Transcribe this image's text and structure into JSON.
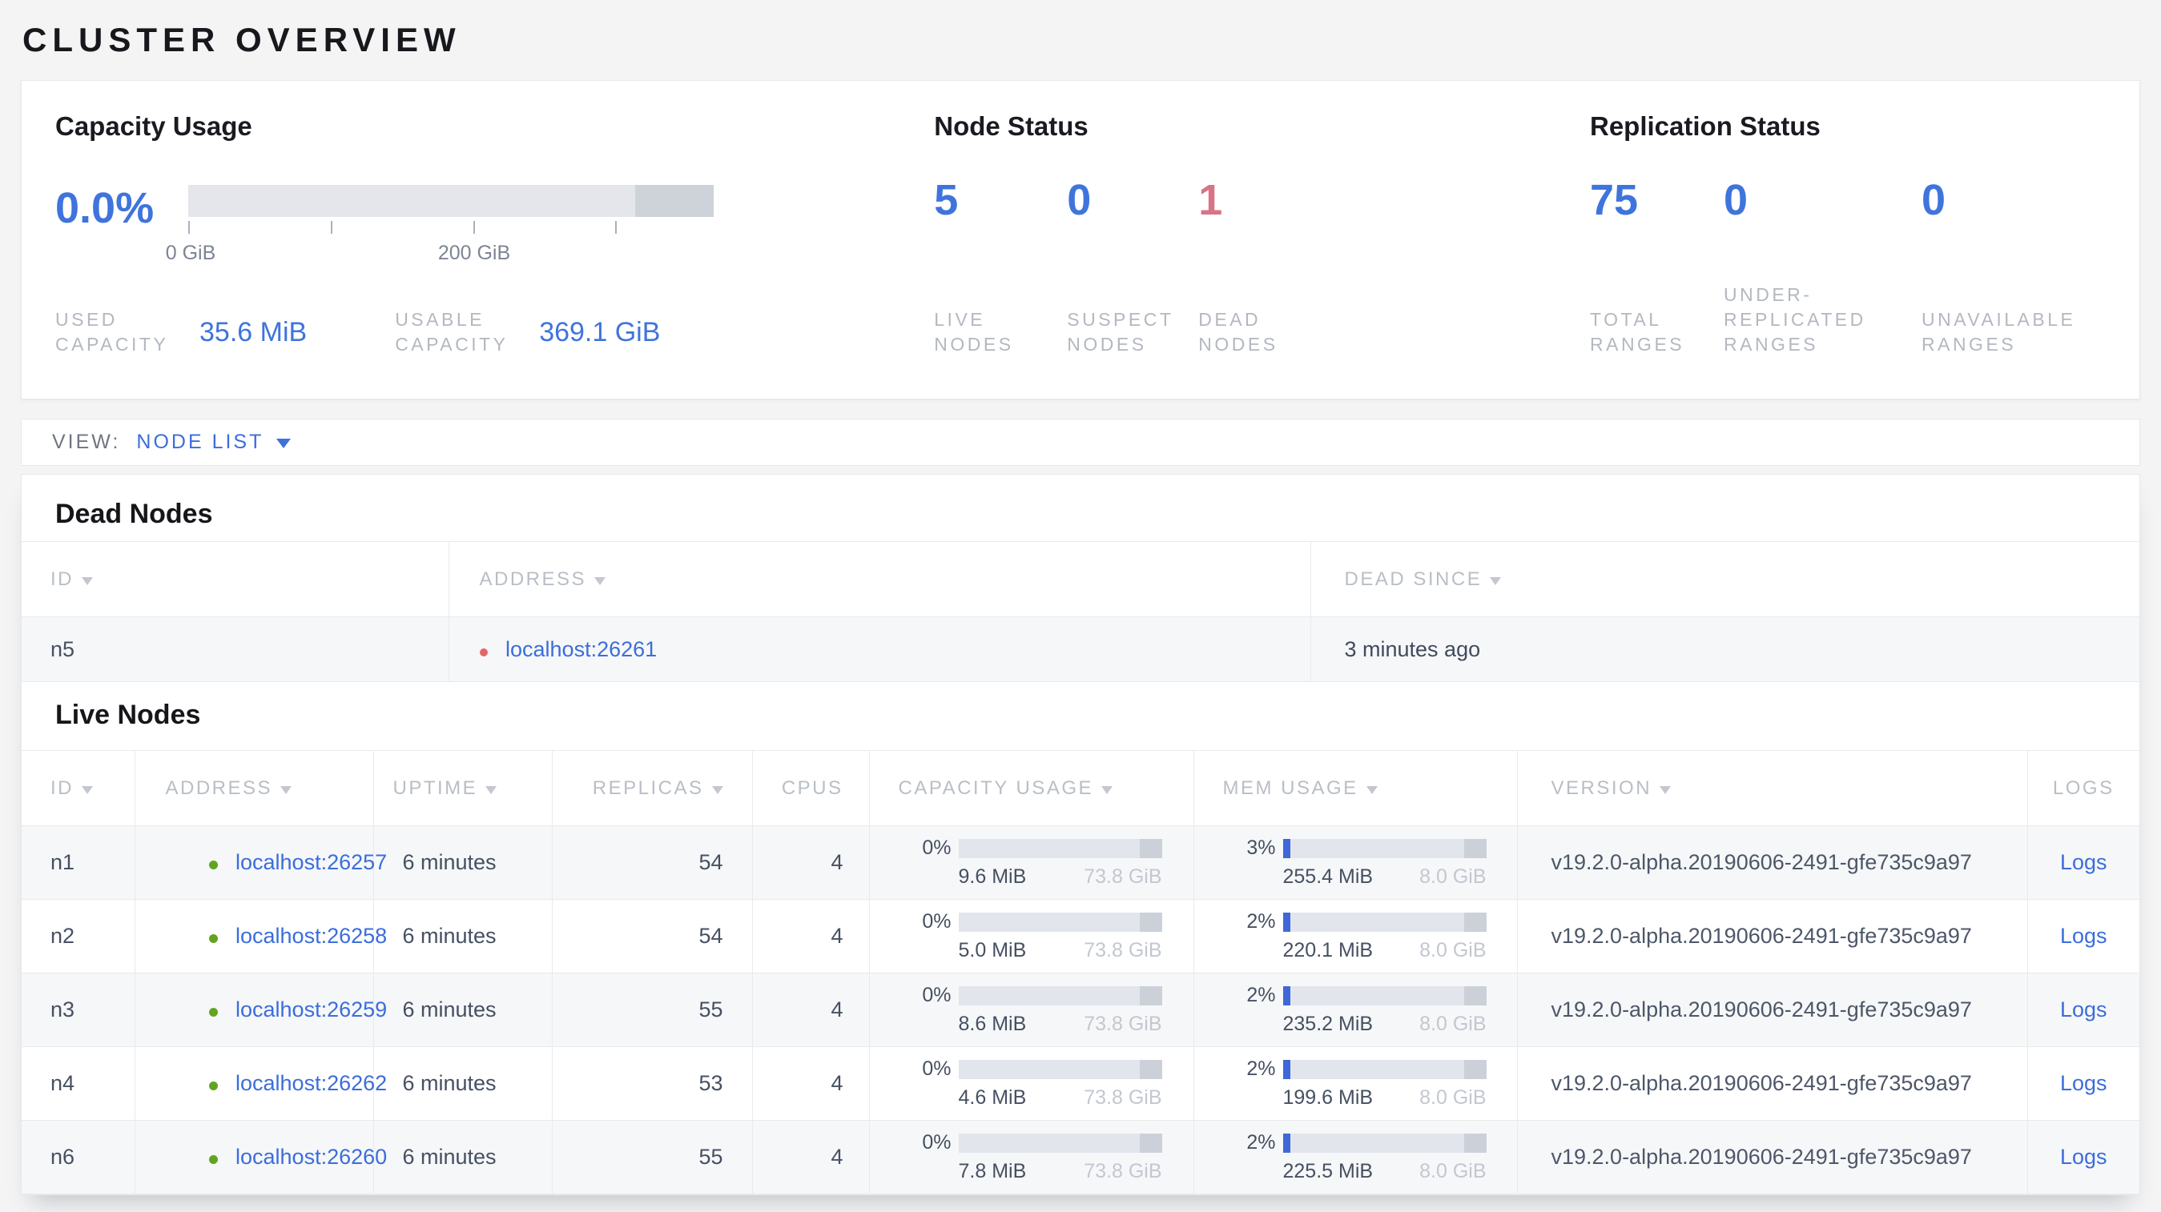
{
  "title": "CLUSTER OVERVIEW",
  "capacity": {
    "heading": "Capacity Usage",
    "percent": "0.0%",
    "axis_tick_0": "0 GiB",
    "axis_tick_200": "200 GiB",
    "used_label": "USED CAPACITY",
    "used_value": "35.6 MiB",
    "usable_label": "USABLE CAPACITY",
    "usable_value": "369.1 GiB"
  },
  "node_status": {
    "heading": "Node Status",
    "stats": [
      {
        "value": "5",
        "label": "LIVE NODES"
      },
      {
        "value": "0",
        "label": "SUSPECT NODES"
      },
      {
        "value": "1",
        "label": "DEAD NODES"
      }
    ]
  },
  "replication": {
    "heading": "Replication Status",
    "stats": [
      {
        "value": "75",
        "label": "TOTAL RANGES"
      },
      {
        "value": "0",
        "label": "UNDER-REPLICATED RANGES"
      },
      {
        "value": "0",
        "label": "UNAVAILABLE RANGES"
      }
    ]
  },
  "view_bar": {
    "label": "VIEW:",
    "selected": "NODE LIST"
  },
  "dead_nodes": {
    "heading": "Dead Nodes",
    "columns": {
      "id": "ID",
      "address": "ADDRESS",
      "dead_since": "DEAD SINCE"
    },
    "rows": [
      {
        "id": "n5",
        "address": "localhost:26261",
        "dead_since": "3 minutes ago"
      }
    ]
  },
  "live_nodes": {
    "heading": "Live Nodes",
    "columns": {
      "id": "ID",
      "address": "ADDRESS",
      "uptime": "UPTIME",
      "replicas": "REPLICAS",
      "cpus": "CPUS",
      "capacity": "CAPACITY USAGE",
      "mem": "MEM USAGE",
      "version": "VERSION",
      "logs": "LOGS"
    },
    "rows": [
      {
        "id": "n1",
        "address": "localhost:26257",
        "uptime": "6 minutes",
        "replicas": "54",
        "cpus": "4",
        "cap_pct": "0%",
        "cap_used": "9.6 MiB",
        "cap_total": "73.8 GiB",
        "mem_pct": "3%",
        "mem_used": "255.4 MiB",
        "mem_total": "8.0 GiB",
        "version": "v19.2.0-alpha.20190606-2491-gfe735c9a97",
        "logs": "Logs"
      },
      {
        "id": "n2",
        "address": "localhost:26258",
        "uptime": "6 minutes",
        "replicas": "54",
        "cpus": "4",
        "cap_pct": "0%",
        "cap_used": "5.0 MiB",
        "cap_total": "73.8 GiB",
        "mem_pct": "2%",
        "mem_used": "220.1 MiB",
        "mem_total": "8.0 GiB",
        "version": "v19.2.0-alpha.20190606-2491-gfe735c9a97",
        "logs": "Logs"
      },
      {
        "id": "n3",
        "address": "localhost:26259",
        "uptime": "6 minutes",
        "replicas": "55",
        "cpus": "4",
        "cap_pct": "0%",
        "cap_used": "8.6 MiB",
        "cap_total": "73.8 GiB",
        "mem_pct": "2%",
        "mem_used": "235.2 MiB",
        "mem_total": "8.0 GiB",
        "version": "v19.2.0-alpha.20190606-2491-gfe735c9a97",
        "logs": "Logs"
      },
      {
        "id": "n4",
        "address": "localhost:26262",
        "uptime": "6 minutes",
        "replicas": "53",
        "cpus": "4",
        "cap_pct": "0%",
        "cap_used": "4.6 MiB",
        "cap_total": "73.8 GiB",
        "mem_pct": "2%",
        "mem_used": "199.6 MiB",
        "mem_total": "8.0 GiB",
        "version": "v19.2.0-alpha.20190606-2491-gfe735c9a97",
        "logs": "Logs"
      },
      {
        "id": "n6",
        "address": "localhost:26260",
        "uptime": "6 minutes",
        "replicas": "55",
        "cpus": "4",
        "cap_pct": "0%",
        "cap_used": "7.8 MiB",
        "cap_total": "73.8 GiB",
        "mem_pct": "2%",
        "mem_used": "225.5 MiB",
        "mem_total": "8.0 GiB",
        "version": "v19.2.0-alpha.20190606-2491-gfe735c9a97",
        "logs": "Logs"
      }
    ]
  },
  "colors": {
    "accent_blue": "#3f74dd",
    "link_blue": "#3b6ddc",
    "dead_red": "#d97487",
    "live_green": "#62a420"
  }
}
